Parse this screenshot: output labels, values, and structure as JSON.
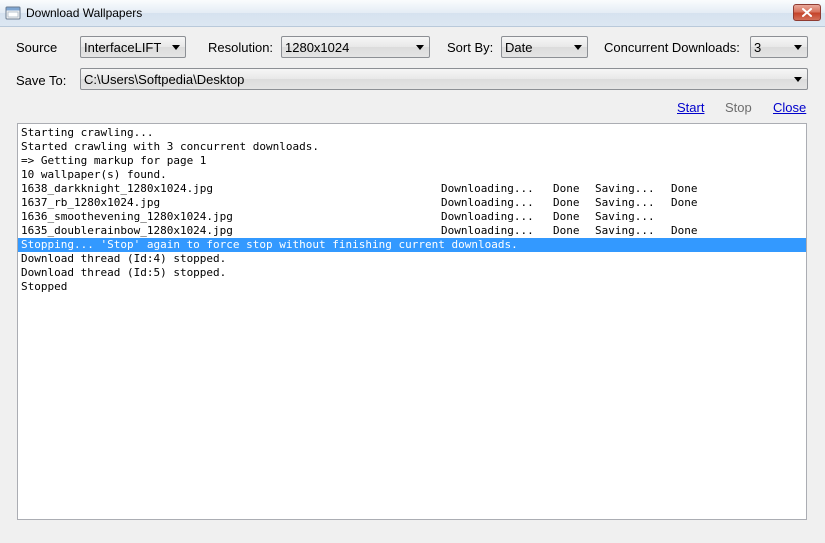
{
  "window": {
    "title": "Download Wallpapers",
    "icon": "app-window-icon",
    "close_icon": "close-icon"
  },
  "controls": {
    "source_label": "Source",
    "source_value": "InterfaceLIFT",
    "resolution_label": "Resolution:",
    "resolution_value": "1280x1024",
    "sortby_label": "Sort By:",
    "sortby_value": "Date",
    "concurrent_label": "Concurrent Downloads:",
    "concurrent_value": "3",
    "saveto_label": "Save To:",
    "saveto_value": "C:\\Users\\Softpedia\\Desktop"
  },
  "actions": {
    "start": "Start",
    "stop": "Stop",
    "close": "Close"
  },
  "log": {
    "lines": [
      [
        "Starting crawling...",
        "",
        "",
        "",
        ""
      ],
      [
        "Started crawling with 3 concurrent downloads.",
        "",
        "",
        "",
        ""
      ],
      [
        "=> Getting markup for page 1",
        "",
        "",
        "",
        ""
      ],
      [
        "10 wallpaper(s) found.",
        "",
        "",
        "",
        ""
      ],
      [
        "1638_darkknight_1280x1024.jpg",
        "Downloading...",
        "Done",
        "Saving...",
        "Done"
      ],
      [
        "1637_rb_1280x1024.jpg",
        "Downloading...",
        "Done",
        "Saving...",
        "Done"
      ],
      [
        "1636_smoothevening_1280x1024.jpg",
        "Downloading...",
        "Done",
        "Saving...",
        ""
      ],
      [
        "1635_doublerainbow_1280x1024.jpg",
        "Downloading...",
        "Done",
        "Saving...",
        "Done"
      ],
      [
        "Stopping... 'Stop' again to force stop without finishing current downloads.",
        "",
        "",
        "",
        ""
      ],
      [
        "Download thread (Id:4) stopped.",
        "",
        "",
        "",
        ""
      ],
      [
        "Download thread (Id:5) stopped.",
        "",
        "",
        "",
        ""
      ],
      [
        "Stopped",
        "",
        "",
        "",
        ""
      ]
    ]
  },
  "colors": {
    "selection": "#3399ff",
    "link": "#0000cc",
    "disabled": "#6d6d6d"
  }
}
